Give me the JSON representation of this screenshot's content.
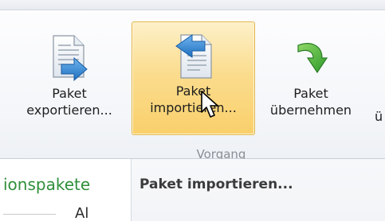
{
  "ribbon": {
    "buttons": [
      {
        "id": "export",
        "line1": "Paket",
        "line2": "exportieren...",
        "icon": "document-export-icon"
      },
      {
        "id": "import",
        "line1": "Paket",
        "line2": "importieren...",
        "icon": "document-import-icon",
        "state": "hovered"
      },
      {
        "id": "accept",
        "line1": "Paket",
        "line2": "übernehmen",
        "icon": "green-curved-arrow-icon"
      }
    ],
    "partial_next_button_text": "ü",
    "group_label": "Vorgang",
    "hover_color": "#fbdd8f"
  },
  "left_pane": {
    "section_title": "ionspakete",
    "section_title_color": "#2f8f3b",
    "partial_text": "Al"
  },
  "right_pane": {
    "title": "Paket importieren..."
  }
}
